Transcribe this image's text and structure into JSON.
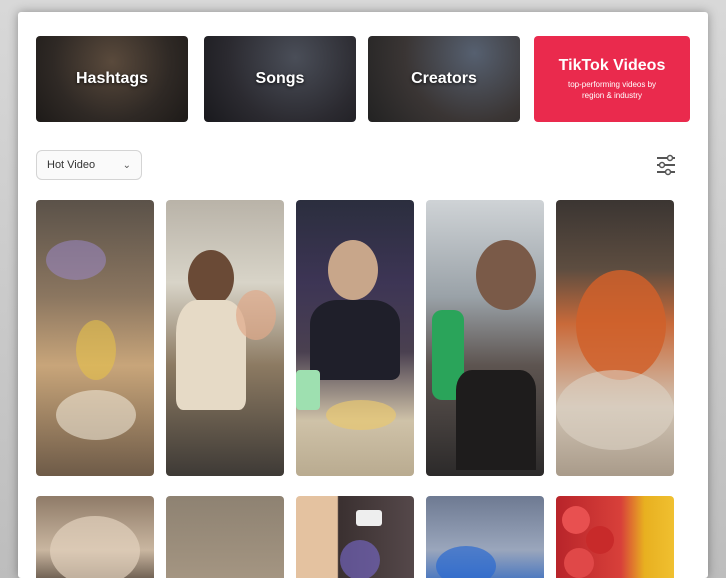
{
  "tabs": [
    {
      "label": "Hashtags",
      "sub": ""
    },
    {
      "label": "Songs",
      "sub": ""
    },
    {
      "label": "Creators",
      "sub": ""
    },
    {
      "label": "TikTok Videos",
      "sub": "top-performing videos by region & industry"
    }
  ],
  "sort": {
    "label": "Hot Video",
    "chevron": "chevron-down-icon"
  },
  "filter": {
    "icon": "filter-icon"
  },
  "videos": {
    "row1": [
      "video-1",
      "video-2",
      "video-3",
      "video-4",
      "video-5"
    ],
    "row2": [
      "video-6",
      "video-7",
      "video-8",
      "video-9",
      "video-10"
    ]
  },
  "colors": {
    "accent": "#ea2a4d",
    "panel": "#ffffff"
  }
}
